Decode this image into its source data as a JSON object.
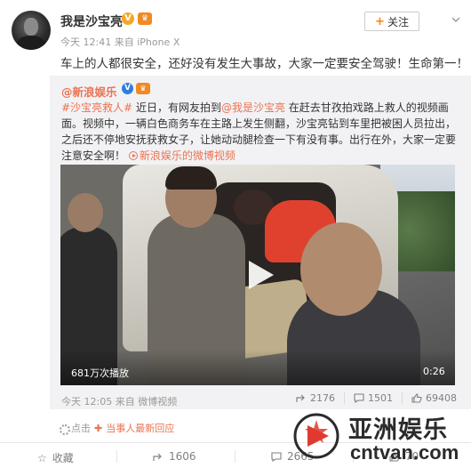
{
  "post": {
    "author": "我是沙宝亮",
    "meta": "今天 12:41 来自 iPhone X",
    "follow_label": "关注",
    "text": "车上的人都很安全，还好没有发生大事故，大家一定要安全驾驶！生命第一！"
  },
  "repost": {
    "author": "@新浪娱乐",
    "text_hashtag": "#沙宝亮救人#",
    "text_part1": " 近日，有网友拍到",
    "text_mention": "@我是沙宝亮",
    "text_part2": " 在赶去甘孜拍戏路上救人的视频画面。视频中，一辆白色商务车在主路上发生侧翻，沙宝亮钻到车里把被困人员拉出，之后还不停地安抚获救女子，让她动动腿检查一下有没有事。出行在外，大家一定要注意安全啊！",
    "text_video_link": "新浪娱乐的微博视频",
    "video": {
      "play_count": "681万次播放",
      "duration": "0:26"
    },
    "meta": "今天 12:05 来自 微博视频",
    "stats": {
      "shares": "2176",
      "comments": "1501",
      "likes": "69408"
    }
  },
  "replies_link": {
    "prefix": "点击",
    "label": "当事人最新回应"
  },
  "actions": {
    "favorite": "收藏",
    "share": "1606",
    "comment": "2665",
    "like": "70"
  },
  "watermark": {
    "cn": "亚洲娱乐",
    "en": "cntvan.com"
  },
  "colors": {
    "accent": "#eb7350",
    "follow_plus": "#ff8200",
    "vip_badge": "#f5a623",
    "blue_v": "#2f7de1"
  }
}
